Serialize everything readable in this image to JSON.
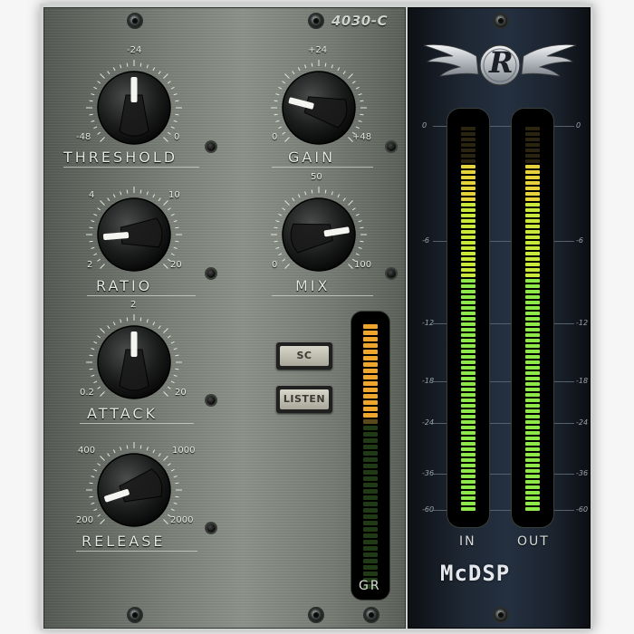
{
  "model": "4030-C",
  "brand": "McDSP",
  "logo_letter": "R",
  "knobs": {
    "threshold": {
      "label": "THRESHOLD",
      "min": "-48",
      "mid": "-24",
      "max": "0",
      "position": 0.5
    },
    "gain": {
      "label": "GAIN",
      "min": "0",
      "mid": "+24",
      "max": "+48",
      "position": 0.22
    },
    "ratio": {
      "label": "RATIO",
      "min": "2",
      "low": "4",
      "high": "10",
      "max": "20",
      "position": 0.15
    },
    "mix": {
      "label": "MIX",
      "min": "0",
      "mid": "50",
      "max": "100",
      "position": 0.8
    },
    "attack": {
      "label": "ATTACK",
      "min": "0.2",
      "mid": "2",
      "max": "20",
      "position": 0.5
    },
    "release": {
      "label": "RELEASE",
      "min": "200",
      "low": "400",
      "high": "1000",
      "max": "2000",
      "position": 0.1
    }
  },
  "buttons": {
    "sc": "SC",
    "listen": "LISTEN"
  },
  "meters": {
    "gr": {
      "label": "GR",
      "level": 0.38
    },
    "in": {
      "label": "IN",
      "level": 0.9
    },
    "out": {
      "label": "OUT",
      "level": 0.9
    }
  },
  "db_scale": [
    "0",
    "-6",
    "-12",
    "-18",
    "-24",
    "-36",
    "-60"
  ],
  "colors": {
    "panel": "#7b8179",
    "meter_panel": "#1e2733",
    "meter_green": "#9bea3a",
    "meter_amber": "#f0a020"
  }
}
